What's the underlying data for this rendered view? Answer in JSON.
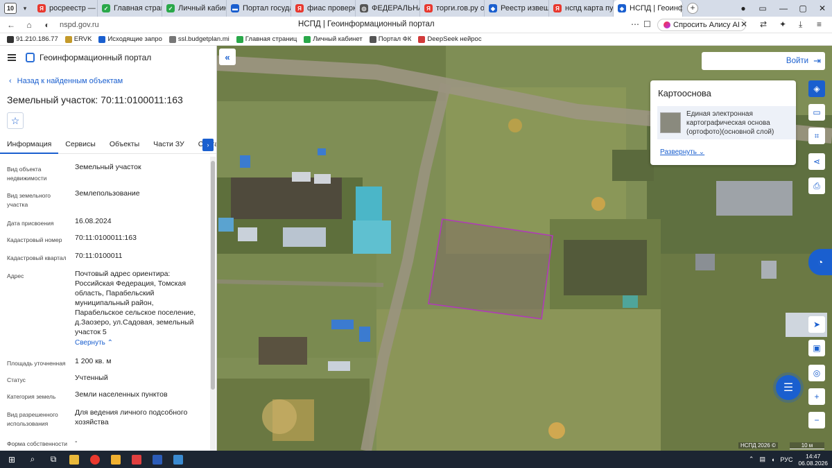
{
  "browser": {
    "tab_count": "10",
    "tabs": [
      {
        "label": "росреестр — Янд",
        "color": "#e8382e",
        "letter": "Я"
      },
      {
        "label": "Главная страница",
        "color": "#2aa84a",
        "letter": "✓"
      },
      {
        "label": "Личный кабинет",
        "color": "#2aa84a",
        "letter": "✓"
      },
      {
        "label": "Портал государств",
        "color": "#1a5fcf",
        "letter": "▬"
      },
      {
        "label": "фиас проверка ад",
        "color": "#e8382e",
        "letter": "Я"
      },
      {
        "label": "ФЕДЕРАЛЬНАЯ И",
        "color": "#555555",
        "letter": "◎"
      },
      {
        "label": "торги.гов.ру офиц",
        "color": "#e8382e",
        "letter": "Я"
      },
      {
        "label": "Реестр извещени",
        "color": "#1a5fcf",
        "letter": "◆"
      },
      {
        "label": "нспд карта публи",
        "color": "#e8382e",
        "letter": "Я"
      }
    ],
    "active_tab": "НСПД | Геоинф",
    "url": "nspd.gov.ru",
    "page_title": "НСПД | Геоинформационный портал",
    "alice_label": "Спросить Алису AI",
    "bookmarks": [
      {
        "label": "91.210.186.77",
        "color": "#333333"
      },
      {
        "label": "ERVK",
        "color": "#c49a2a"
      },
      {
        "label": "Исходящие запро",
        "color": "#1a5fcf"
      },
      {
        "label": "ssl.budgetplan.mi",
        "color": "#777777"
      },
      {
        "label": "Главная страниц",
        "color": "#2aa84a"
      },
      {
        "label": "Личный кабинет",
        "color": "#2aa84a"
      },
      {
        "label": "Портал ФК",
        "color": "#555555"
      },
      {
        "label": "DeepSeek нейрос",
        "color": "#d23a3a"
      }
    ]
  },
  "sidebar": {
    "portal_name": "Геоинформационный портал",
    "back_link": "Назад к найденным объектам",
    "object_title": "Земельный участок: 70:11:0100011:163",
    "tabs": [
      "Информация",
      "Сервисы",
      "Объекты",
      "Части ЗУ",
      "Состав"
    ],
    "attributes": [
      {
        "label": "Вид объекта недвижимости",
        "value": "Земельный участок"
      },
      {
        "label": "Вид земельного участка",
        "value": "Землепользование"
      },
      {
        "label": "Дата присвоения",
        "value": "16.08.2024"
      },
      {
        "label": "Кадастровый номер",
        "value": "70:11:0100011:163"
      },
      {
        "label": "Кадастровый квартал",
        "value": "70:11:0100011"
      },
      {
        "label": "Адрес",
        "value": "Почтовый адрес ориентира: Российская Федерация, Томская область, Парабельский муниципальный район, Парабельское сельское поселение, д.Заозеро, ул.Садовая, земельный участок 5"
      },
      {
        "label": "Площадь уточненная",
        "value": "1 200 кв. м"
      },
      {
        "label": "Статус",
        "value": "Учтенный"
      },
      {
        "label": "Категория земель",
        "value": "Земли населенных пунктов"
      },
      {
        "label": "Вид разрешенного использования",
        "value": "Для ведения личного подсобного хозяйства"
      },
      {
        "label": "Форма собственности",
        "value": "-"
      }
    ],
    "collapse_label": "Свернуть"
  },
  "map": {
    "login_label": "Войти",
    "basemap": {
      "title": "Картооснова",
      "layer": "Единая электронная картографическая основа (ортофото)(основной слой)",
      "expand": "Развернуть"
    },
    "copyright": "НСПД 2026 ©",
    "scale": "10 м",
    "accent": "#1a5fcf",
    "parcel_color": "#b03ab8"
  },
  "taskbar": {
    "lang": "РУС",
    "time": "14:47",
    "date": "06.08.2026"
  }
}
